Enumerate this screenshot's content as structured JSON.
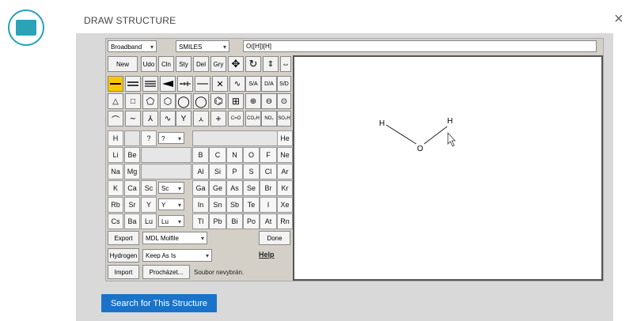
{
  "header": {
    "title": "DRAW STRUCTURE",
    "close_glyph": "×"
  },
  "toolbar": {
    "broadband_select": "Broadband",
    "format_select": "SMILES",
    "smiles_value": "O([H])[H]"
  },
  "tool_row1": [
    "New",
    "Udo",
    "Cln",
    "Sty",
    "Del",
    "Gry"
  ],
  "tool_row2_labels": [
    "S/A",
    "D/A",
    "S/D"
  ],
  "tool_row4_labels": [
    "C=O",
    "CO₂H",
    "NO₂",
    "SO₃H"
  ],
  "periodic": {
    "row1": {
      "h": "H",
      "q": "?",
      "sel": "?",
      "he": "He"
    },
    "row2": [
      "Li",
      "Be",
      "B",
      "C",
      "N",
      "O",
      "F",
      "Ne"
    ],
    "row3": [
      "Na",
      "Mg",
      "Al",
      "Si",
      "P",
      "S",
      "Cl",
      "Ar"
    ],
    "row4": [
      "K",
      "Ca",
      "Sc",
      "Ga",
      "Ge",
      "As",
      "Se",
      "Br",
      "Kr"
    ],
    "row4_sel": "Sc",
    "row5": [
      "Rb",
      "Sr",
      "Y",
      "In",
      "Sn",
      "Sb",
      "Te",
      "I",
      "Xe"
    ],
    "row5_sel": "Y",
    "row6": [
      "Cs",
      "Ba",
      "Lu",
      "Tl",
      "Pb",
      "Bi",
      "Po",
      "At",
      "Rn"
    ],
    "row6_sel": "Lu"
  },
  "bottom": {
    "export_label": "Export",
    "export_format": "MDL Molfile",
    "done_label": "Done",
    "hydrogen_label": "Hydrogen",
    "hydrogen_mode": "Keep As Is",
    "help_label": "Help",
    "import_label": "Import",
    "browse_label": "Procházet...",
    "no_file_text": "Soubor nevybrán."
  },
  "molecule": {
    "atom_h1": "H",
    "atom_o": "O",
    "atom_h2": "H"
  },
  "search_button": "Search for This Structure"
}
